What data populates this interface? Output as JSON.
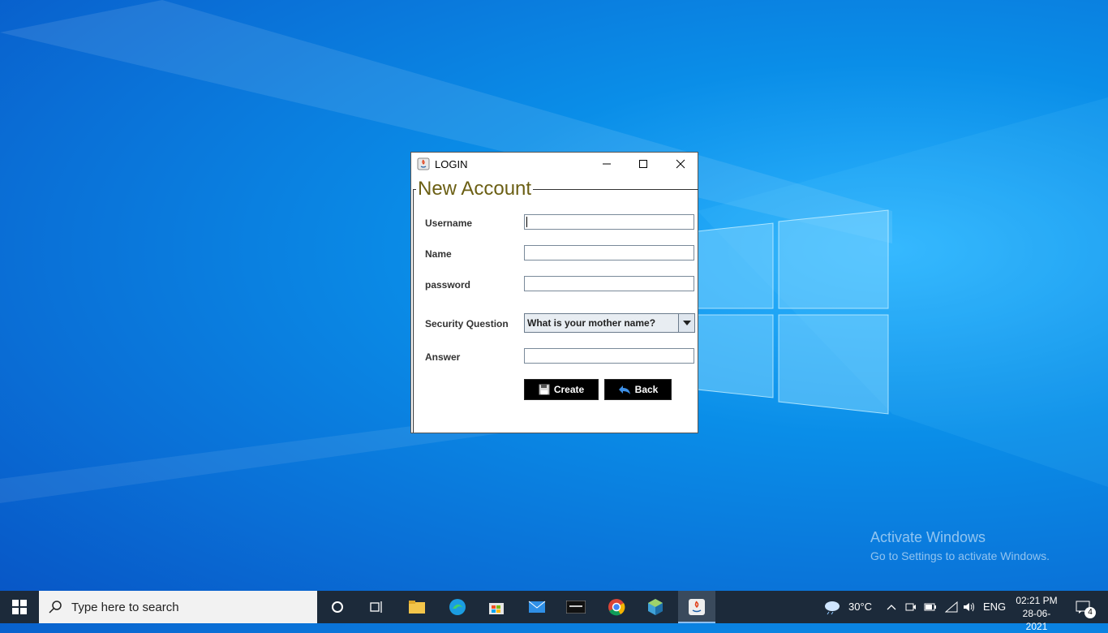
{
  "desktop": {
    "watermark": {
      "line1": "Activate Windows",
      "line2": "Go to Settings to activate Windows."
    }
  },
  "dialog": {
    "title": "LOGIN",
    "app_icon": "java-icon",
    "legend": "New Account",
    "fields": {
      "username_label": "Username",
      "name_label": "Name",
      "password_label": "password",
      "security_label": "Security Question",
      "answer_label": "Answer"
    },
    "security_question_selected": "What is your mother name?",
    "buttons": {
      "create": "Create",
      "back": "Back"
    }
  },
  "taskbar": {
    "search_placeholder": "Type here to search",
    "weather": "30°C",
    "language": "ENG",
    "time": "02:21 PM",
    "date": "28-06-2021",
    "notification_count": "4",
    "apps": [
      "task-view-icon",
      "file-explorer-icon",
      "edge-icon",
      "store-icon",
      "mail-icon",
      "mysql-icon",
      "chrome-icon",
      "netbeans-icon",
      "java-icon"
    ]
  }
}
